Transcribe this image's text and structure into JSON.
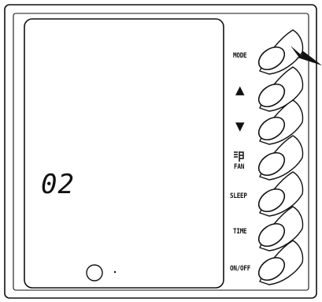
{
  "display": {
    "value": "02"
  },
  "buttons": [
    {
      "id": "mode",
      "label": "MODE",
      "icon": ""
    },
    {
      "id": "up",
      "label": "",
      "icon": "up-triangle-icon",
      "glyph": "▲"
    },
    {
      "id": "down",
      "label": "",
      "icon": "down-triangle-icon",
      "glyph": "▼"
    },
    {
      "id": "fan",
      "label": "FAN",
      "icon": "fan-icon"
    },
    {
      "id": "sleep",
      "label": "SLEEP",
      "icon": ""
    },
    {
      "id": "time",
      "label": "TIME",
      "icon": ""
    },
    {
      "id": "onoff",
      "label": "ON/OFF",
      "icon": ""
    }
  ],
  "pointer": {
    "target": "mode",
    "icon": "pointer-arrow-icon"
  },
  "colors": {
    "ink": "#111111",
    "background": "#ffffff"
  }
}
